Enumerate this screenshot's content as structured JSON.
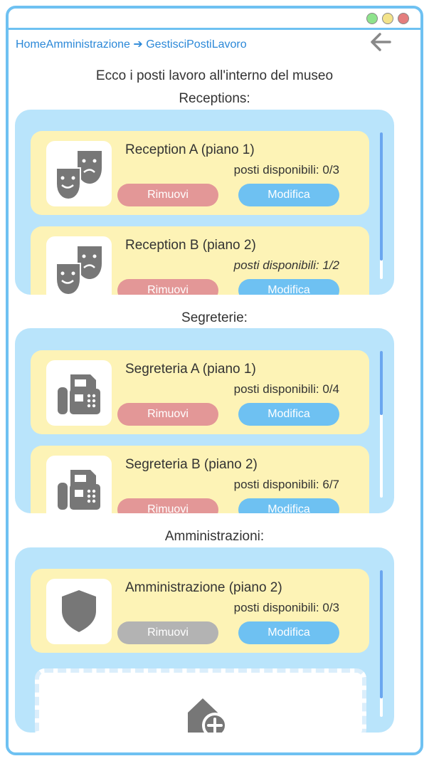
{
  "breadcrumb": "HomeAmministrazione ➔ GestisciPostiLavoro",
  "subtitle": "Ecco i posti lavoro all'interno del museo",
  "sections": [
    {
      "title": "Receptions:",
      "cards": [
        {
          "name": "Reception A (piano 1)",
          "available": "posti disponibili: 0/3",
          "remove": "Rimuovi",
          "edit": "Modifica",
          "icon": "theater-masks-icon"
        },
        {
          "name": "Reception B (piano 2)",
          "available": "posti disponibili: 1/2",
          "remove": "Rimuovi",
          "edit": "Modifica",
          "icon": "theater-masks-icon"
        }
      ]
    },
    {
      "title": "Segreterie:",
      "cards": [
        {
          "name": "Segreteria A (piano 1)",
          "available": "posti disponibili: 0/4",
          "remove": "Rimuovi",
          "edit": "Modifica",
          "icon": "fax-icon"
        },
        {
          "name": "Segreteria B (piano 2)",
          "available": "posti disponibili: 6/7",
          "remove": "Rimuovi",
          "edit": "Modifica",
          "icon": "fax-icon"
        }
      ]
    },
    {
      "title": "Amministrazioni:",
      "cards": [
        {
          "name": "Amministrazione (piano 2)",
          "available": "posti disponibili: 0/3",
          "remove": "Rimuovi",
          "edit": "Modifica",
          "icon": "shield-icon",
          "remove_disabled": true
        }
      ],
      "add_card_icon": "house-add-icon"
    }
  ],
  "colors": {
    "accent_blue": "#6ec1f2",
    "panel_bg": "#b9e4fb",
    "card_bg": "#fdf3b6",
    "remove_red": "#e39797",
    "disabled_gray": "#b3b3b3",
    "link_blue": "#2b88d8"
  }
}
